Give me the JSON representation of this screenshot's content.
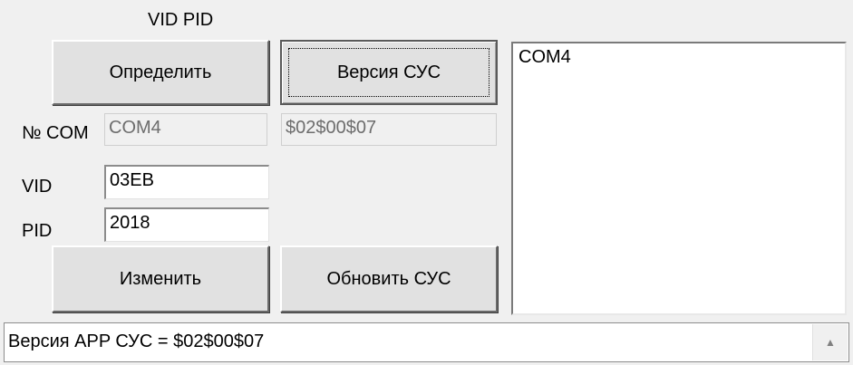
{
  "group": {
    "title": "VID PID"
  },
  "buttons": {
    "detect": "Определить",
    "version": "Версия СУС",
    "change": "Изменить",
    "update": "Обновить СУС"
  },
  "labels": {
    "com": "№ COM",
    "vid": "VID",
    "pid": "PID"
  },
  "fields": {
    "com_value": "COM4",
    "version_value": "$02$00$07",
    "vid_value": "03EB",
    "pid_value": "2018"
  },
  "ports_list": [
    "COM4"
  ],
  "status": {
    "text": "Версия APP СУС = $02$00$07"
  },
  "icons": {
    "scroll_up": "▲"
  }
}
